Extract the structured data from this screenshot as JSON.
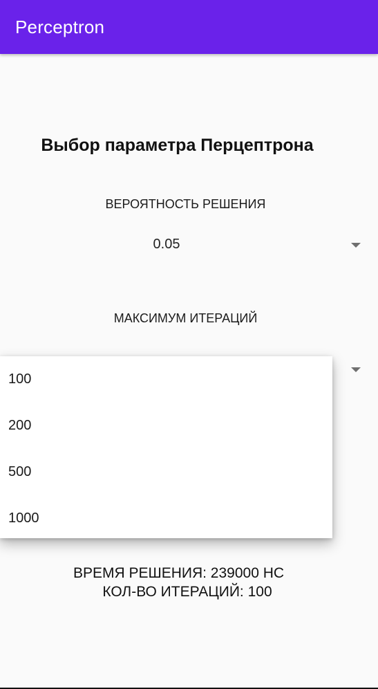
{
  "app_bar": {
    "title": "Perceptron",
    "color": "#6a22ea"
  },
  "main": {
    "heading": "Выбор параметра Перцептрона",
    "probability": {
      "label": "ВЕРОЯТНОСТЬ РЕШЕНИЯ",
      "value": "0.05"
    },
    "max_iterations": {
      "label": "МАКСИМУМ ИТЕРАЦИЙ",
      "options": [
        "100",
        "200",
        "500",
        "1000"
      ]
    },
    "results": {
      "time": "ВРЕМЯ РЕШЕНИЯ: 239000 НС",
      "iterations": "КОЛ-ВО ИТЕРАЦИЙ: 100"
    }
  },
  "icons": {
    "spinner_caret": "caret-down-icon"
  }
}
